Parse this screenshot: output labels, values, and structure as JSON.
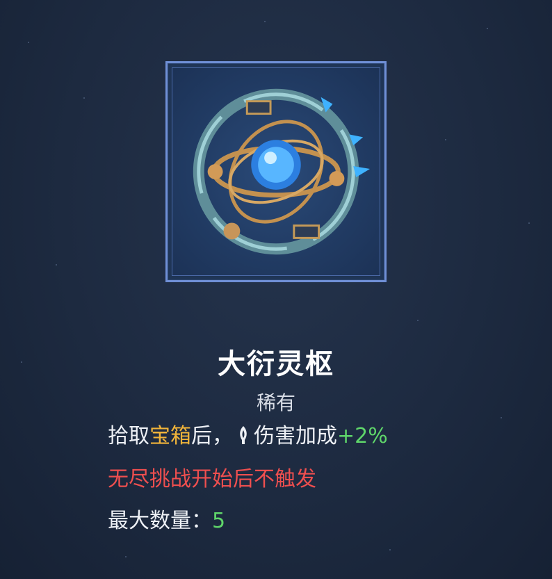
{
  "item": {
    "icon_name": "armillary-sphere-relic-icon",
    "name": "大衍灵枢",
    "rarity": "稀有"
  },
  "description": {
    "pickup_prefix": "拾取",
    "pickup_highlight": "宝箱",
    "pickup_suffix": "后，",
    "stat_icon": "claw-damage-icon",
    "stat_label": "伤害加成",
    "stat_value": "+2%",
    "restriction": "无尽挑战开始后不触发",
    "max_label": "最大数量：",
    "max_value": "5"
  },
  "colors": {
    "background": "#1d2a40",
    "frame_border": "#6f8fd6",
    "highlight_gold": "#f1b43a",
    "value_green": "#5fd66a",
    "warning_red": "#ef4f4f"
  }
}
